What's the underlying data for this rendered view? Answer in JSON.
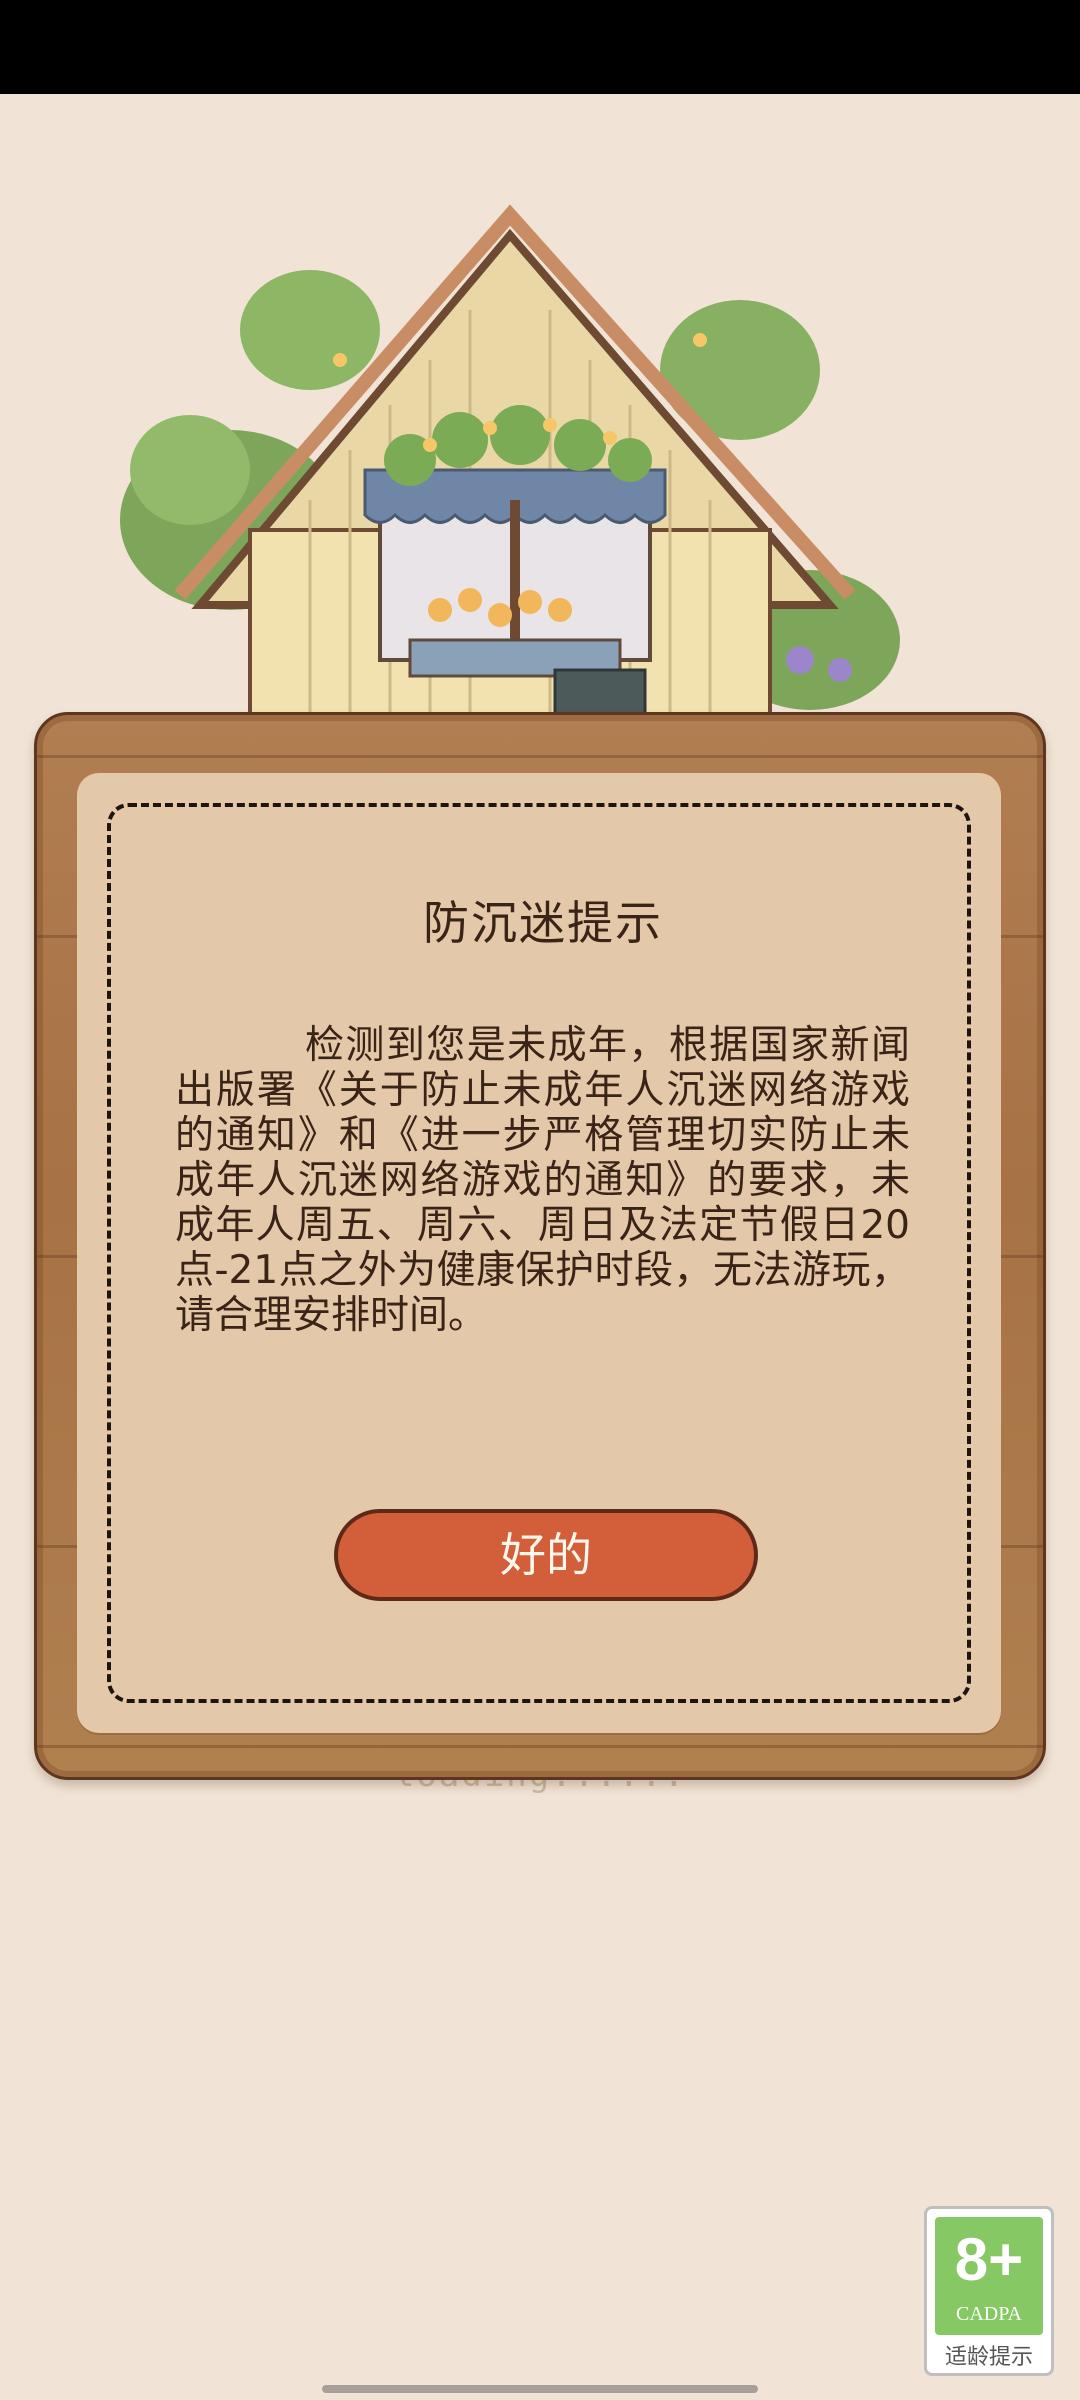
{
  "dialog": {
    "title": "防沉迷提示",
    "body": "检测到您是未成年，根据国家新闻出版署《关于防止未成年人沉迷网络游戏的通知》和《进一步严格管理切实防止未成年人沉迷网络游戏的通知》的要求，未成年人周五、周六、周日及法定节假日20点-21点之外为健康保护时段，无法游玩，请合理安排时间。",
    "ok_label": "好的"
  },
  "loading": {
    "text": "loading......"
  },
  "age_badge": {
    "rating": "8+",
    "org": "CADPA",
    "note": "适龄提示"
  },
  "icons": {
    "illustration": "house-illustration",
    "badge": "age-rating-badge"
  },
  "colors": {
    "background": "#f1e4d6",
    "wood": "#a77244",
    "panel": "#e3c9a9",
    "button": "#d25f3a",
    "badge": "#86c964"
  }
}
